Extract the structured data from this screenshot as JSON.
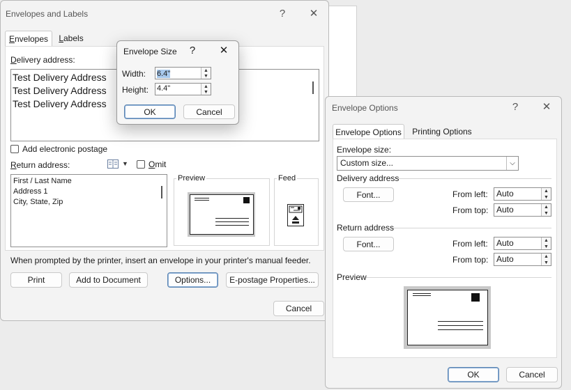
{
  "main": {
    "title": "Envelopes and Labels",
    "help": "?",
    "close": "✕",
    "tabs": [
      {
        "label": "Envelopes",
        "accel": "E",
        "rest": "nvelopes"
      },
      {
        "label": "Labels",
        "accel": "L",
        "rest": "abels"
      }
    ],
    "delivery_label_accel": "D",
    "delivery_label_rest": "elivery address:",
    "delivery_lines": [
      "Test Delivery Address",
      "Test Delivery Address",
      "Test Delivery Address"
    ],
    "add_postage_label": "Add electronic postage",
    "return_label_accel": "R",
    "return_label_rest": "eturn address:",
    "omit_accel": "O",
    "omit_rest": "mit",
    "return_lines": [
      "First / Last Name",
      "Address 1",
      "City, State, Zip"
    ],
    "preview_label": "Preview",
    "feed_label": "Feed",
    "note": "When prompted by the printer, insert an envelope in your printer's manual feeder.",
    "buttons": {
      "print": "Print",
      "add_to_document": "Add to Document",
      "options": "Options...",
      "epostage": "E-postage Properties...",
      "cancel": "Cancel"
    }
  },
  "size_dialog": {
    "title": "Envelope Size",
    "help": "?",
    "close": "✕",
    "width_label": "Width:",
    "width_value": "6.4\"",
    "height_label": "Height:",
    "height_value": "4.4\"",
    "ok": "OK",
    "cancel": "Cancel"
  },
  "options_dialog": {
    "title": "Envelope Options",
    "help": "?",
    "close": "✕",
    "tabs": [
      "Envelope Options",
      "Printing Options"
    ],
    "envelope_size_label": "Envelope size:",
    "envelope_size_value": "Custom size...",
    "delivery_group": "Delivery address",
    "return_group": "Return address",
    "font_button": "Font...",
    "from_left": "From left:",
    "from_top": "From top:",
    "delivery_from_left": "Auto",
    "delivery_from_top": "Auto",
    "return_from_left": "Auto",
    "return_from_top": "Auto",
    "preview_label": "Preview",
    "ok": "OK",
    "cancel": "Cancel"
  }
}
